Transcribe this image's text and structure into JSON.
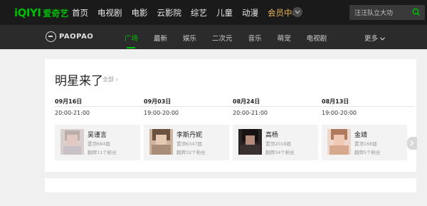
{
  "brand": {
    "logo_text": "iQIYI",
    "logo_cn": "爱奇艺",
    "accent": "#00be06"
  },
  "top_nav": {
    "items": [
      "首页",
      "电视剧",
      "电影",
      "云影院",
      "综艺",
      "儿童",
      "动漫"
    ],
    "vip_label": "会员中心"
  },
  "search": {
    "placeholder": "汪汪队立大功"
  },
  "sub_nav": {
    "logo_text": "PAOPAO",
    "tabs": [
      "广场",
      "最新",
      "娱乐",
      "二次元",
      "音乐",
      "萌宠",
      "电视剧"
    ],
    "active_tab": "广场",
    "more_label": "更多"
  },
  "section": {
    "title": "明星来了",
    "all_label": "全部"
  },
  "stars": [
    {
      "date": "09月16日",
      "time": "20:00-21:00",
      "name": "吴谨言",
      "posts": "置顶684届",
      "fans": "翻牌11个粉丝"
    },
    {
      "date": "09月03日",
      "time": "19:00-20:00",
      "name": "李斯丹妮",
      "posts": "置顶6347届",
      "fans": "翻牌32个粉丝"
    },
    {
      "date": "08月24日",
      "time": "20:00-21:00",
      "name": "高杨",
      "posts": "置顶2018届",
      "fans": "翻牌34个粉丝"
    },
    {
      "date": "08月13日",
      "time": "19:00-20:00",
      "name": "金靖",
      "posts": "置顶168届",
      "fans": "翻牌5个粉丝"
    }
  ]
}
